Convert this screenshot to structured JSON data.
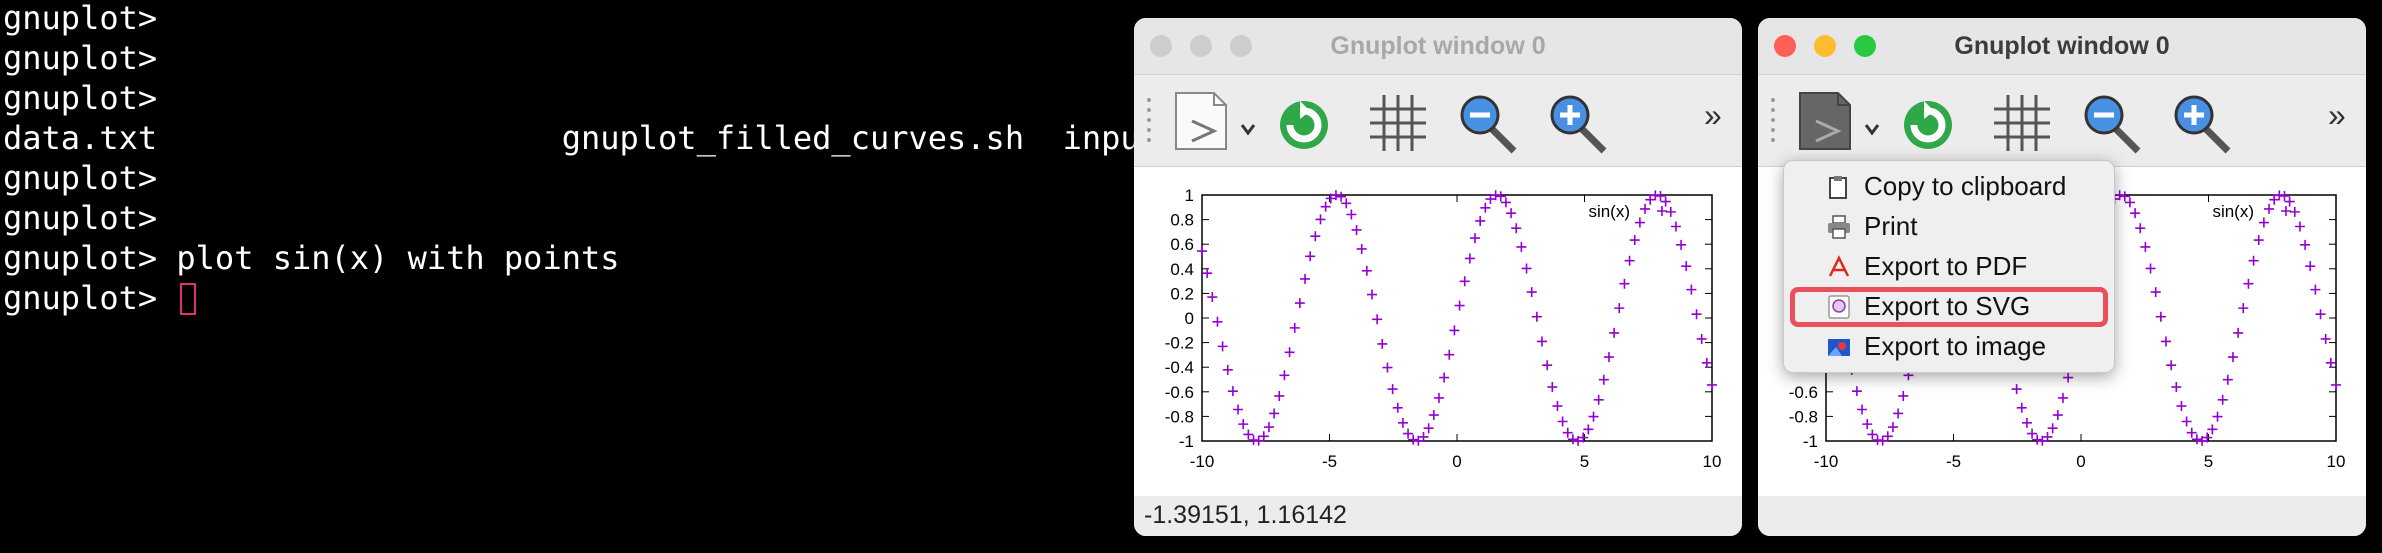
{
  "terminal": {
    "lines": [
      "gnuplot>",
      "gnuplot>",
      "gnuplot>",
      "data.txt                     gnuplot_filled_curves.sh  input.txt",
      "gnuplot>",
      "gnuplot>",
      "gnuplot> plot sin(x) with points",
      "gnuplot> "
    ]
  },
  "window_left": {
    "title": "Gnuplot window 0",
    "status": "-1.39151, 1.16142",
    "toolbar": {
      "overflow": "»"
    }
  },
  "window_right": {
    "title": "Gnuplot window 0",
    "toolbar": {
      "overflow": "»"
    }
  },
  "export_menu": {
    "items": [
      {
        "label": "Copy to clipboard",
        "icon": "clipboard-icon"
      },
      {
        "label": "Print",
        "icon": "printer-icon"
      },
      {
        "label": "Export to PDF",
        "icon": "pdf-icon"
      },
      {
        "label": "Export to SVG",
        "icon": "svg-icon"
      },
      {
        "label": "Export to image",
        "icon": "image-icon"
      }
    ],
    "highlighted_item": "Export to SVG",
    "highlight_color": "#e8505b"
  },
  "colors": {
    "point_color": "#9400d3",
    "close": "#fe5f57",
    "minimize": "#febc2e",
    "maximize": "#28c840",
    "inactive_light": "#cdcdcd"
  },
  "chart_data": {
    "type": "scatter",
    "series": [
      {
        "name": "sin(x)",
        "function": "sin(x)",
        "marker": "+",
        "samples": 100
      }
    ],
    "xlim": [
      -10,
      10
    ],
    "ylim": [
      -1,
      1
    ],
    "x_ticks": [
      "-10",
      "-5",
      "0",
      "5",
      "10"
    ],
    "y_ticks": [
      "1",
      "0.8",
      "0.6",
      "0.4",
      "0.2",
      "0",
      "-0.2",
      "-0.4",
      "-0.6",
      "-0.8",
      "-1"
    ],
    "legend_position": "top-right"
  }
}
